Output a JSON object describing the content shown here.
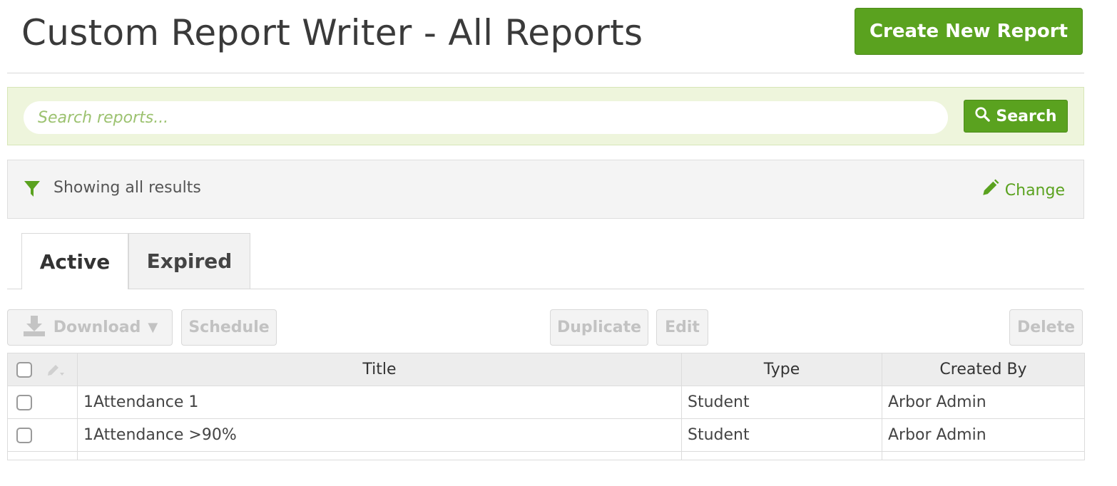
{
  "header": {
    "title": "Custom Report Writer - All Reports",
    "create_button_label": "Create New Report"
  },
  "search": {
    "placeholder": "Search reports...",
    "value": "",
    "button_label": "Search"
  },
  "filter": {
    "status_text": "Showing all results",
    "change_label": "Change"
  },
  "tabs": [
    {
      "label": "Active",
      "selected": true
    },
    {
      "label": "Expired",
      "selected": false
    }
  ],
  "toolbar": {
    "download_label": "Download",
    "schedule_label": "Schedule",
    "duplicate_label": "Duplicate",
    "edit_label": "Edit",
    "delete_label": "Delete"
  },
  "table": {
    "columns": [
      "Title",
      "Type",
      "Created By"
    ],
    "rows": [
      {
        "title": "1Attendance 1",
        "type": "Student",
        "created_by": "Arbor Admin"
      },
      {
        "title": "1Attendance >90%",
        "type": "Student",
        "created_by": "Arbor Admin"
      }
    ]
  },
  "colors": {
    "accent": "#5aa21f",
    "search_band": "#eef5dc",
    "placeholder": "#9cc270"
  },
  "icons": {
    "search_button": "search-icon",
    "filter": "filter-icon",
    "change": "pencil-icon",
    "download": "download-icon",
    "download_menu": "caret-down-icon",
    "bulk_edit": "pencil-dropdown-icon"
  }
}
